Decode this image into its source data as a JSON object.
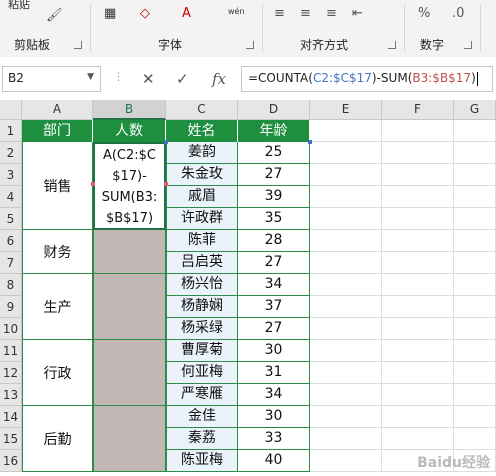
{
  "ribbon": {
    "paste_label": "粘贴",
    "font_size_label": "wén",
    "groups": [
      "剪贴板",
      "字体",
      "对齐方式",
      "数字"
    ]
  },
  "name_box": "B2",
  "formula": {
    "prefix": "=COUNTA(",
    "ref1": "C2:$C$17",
    "mid": ")-SUM(",
    "ref2": "B3:$B$17",
    "suffix": ")"
  },
  "columns": [
    "A",
    "B",
    "C",
    "D",
    "E",
    "F",
    "G"
  ],
  "rows": [
    "1",
    "2",
    "3",
    "4",
    "5",
    "6",
    "7",
    "8",
    "9",
    "10",
    "11",
    "12",
    "13",
    "14",
    "15",
    "16"
  ],
  "headers": [
    "部门",
    "人数",
    "姓名",
    "年龄"
  ],
  "departments": [
    "销售",
    "财务",
    "生产",
    "行政",
    "后勤"
  ],
  "active_cell_text": "A(C2:$C\n$17)-\nSUM(B3:\n$B$17)",
  "names": [
    "姜韵",
    "朱金玫",
    "戚眉",
    "许政群",
    "陈菲",
    "吕启英",
    "杨兴怡",
    "杨静娴",
    "杨采绿",
    "曹厚菊",
    "何亚梅",
    "严寒雁",
    "金佳",
    "秦荔",
    "陈亚梅"
  ],
  "ages": [
    "25",
    "27",
    "39",
    "35",
    "28",
    "27",
    "34",
    "37",
    "27",
    "30",
    "31",
    "34",
    "30",
    "33",
    "40"
  ],
  "watermark": "Baidu经验",
  "colors": {
    "header_green": "#1d8f3f",
    "name_fill": "#eaf2fa",
    "merged_fill": "#c1b7b4",
    "ref1": "#4472c4",
    "ref2": "#c0504d"
  }
}
